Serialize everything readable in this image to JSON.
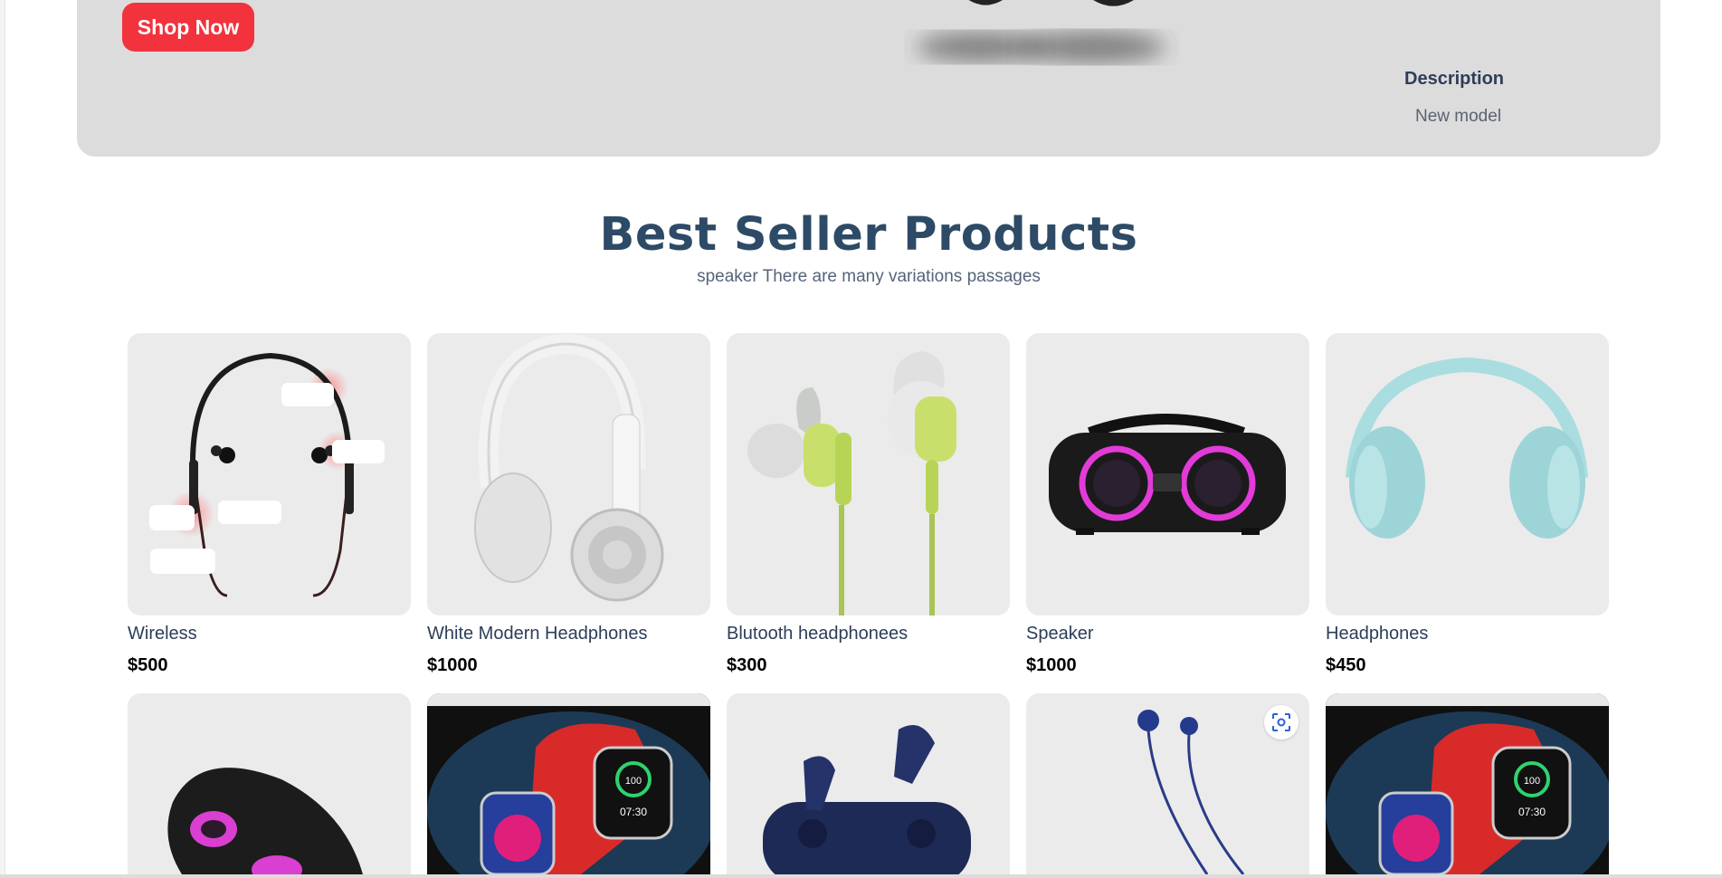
{
  "hero": {
    "cta_label": "Shop Now",
    "description_title": "Description",
    "description_text": "New model",
    "accent_color": "#f2323d"
  },
  "best_sellers": {
    "title": "Best Seller Products",
    "subtitle": "speaker There are many variations passages"
  },
  "products": [
    {
      "name": "Wireless",
      "price": "$500",
      "image": "neckband-earphones"
    },
    {
      "name": "White Modern Headphones",
      "price": "$1000",
      "image": "white-headphones"
    },
    {
      "name": "Blutooth headphonees",
      "price": "$300",
      "image": "green-earphones"
    },
    {
      "name": "Speaker",
      "price": "$1000",
      "image": "boombox-speaker"
    },
    {
      "name": "Headphones",
      "price": "$450",
      "image": "teal-headphones"
    }
  ],
  "second_row": [
    {
      "image": "portable-speaker"
    },
    {
      "image": "smartwatch"
    },
    {
      "image": "earbuds-case"
    },
    {
      "image": "blue-earphones"
    },
    {
      "image": "smartwatch"
    }
  ],
  "screen_labels": {
    "watch_percent": "100",
    "watch_time": "07:30"
  },
  "icons": {
    "scan": "visual-search-icon"
  },
  "colors": {
    "title": "#2d4a66",
    "text": "#2c3e57",
    "card_bg": "#ebebeb",
    "hero_bg": "#dcdcdc"
  }
}
